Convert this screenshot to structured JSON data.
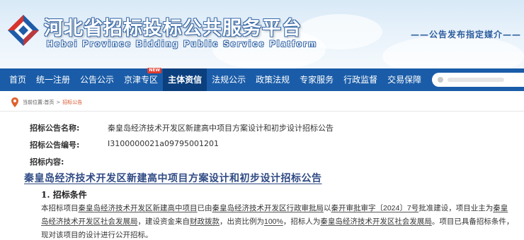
{
  "header": {
    "title": "河北省招标投标公共服务平台",
    "subtitle": "Hebei Province Bidding Public Service Platform",
    "slogan": "——公告发布指定媒介——"
  },
  "nav": {
    "items": [
      {
        "label": "首页"
      },
      {
        "label": "统一注册"
      },
      {
        "label": "公告公示"
      },
      {
        "label": "京津专区",
        "badge": "NEW"
      },
      {
        "label": "主体资信"
      },
      {
        "label": "法规公示"
      },
      {
        "label": "政策法规"
      },
      {
        "label": "专家服务"
      },
      {
        "label": "行政监督"
      },
      {
        "label": "交易保障"
      }
    ],
    "active_index": 4
  },
  "breadcrumb": {
    "prefix": "当前位置:",
    "home": "首页",
    "separator": ">",
    "current": "招标公告"
  },
  "detail": {
    "name_label": "招标公告名称:",
    "name_value": "秦皇岛经济技术开发区新建高中项目方案设计和初步设计招标公告",
    "code_label": "招标公告编号:",
    "code_value": "I3100000021a09795001201",
    "content_label": "招标内容:"
  },
  "notice": {
    "title": "秦皇岛经济技术开发区新建高中项目方案设计和初步设计招标公告",
    "section1_heading": "1. 招标条件",
    "paragraph": {
      "t1": "本招标项目",
      "u1": "秦皇岛经济技术开发区新建高中项目",
      "t2": "已由",
      "u2": "秦皇岛经济技术开发区行政审批局",
      "t3": "以",
      "u3": "秦开审批审字〔2024〕7号",
      "t4": "批准建设，项目业主为",
      "u4": "秦皇岛经济技术开发区社会发展局",
      "t5": "，建设资金来自",
      "u5": "财政拨款",
      "t6": "，出资比例为",
      "u6": "100%",
      "t7": "，招标人为",
      "u7": "秦皇岛经济技术开发区社会发展局",
      "t8": "。项目已具备招标条件，现对该项目的设计进行公开招标。"
    }
  },
  "colors": {
    "nav_bg": "#1a5ca8",
    "nav_active": "#0b3f7d",
    "title_blue": "#2f4a84",
    "breadcrumb_current": "#d6532a"
  }
}
